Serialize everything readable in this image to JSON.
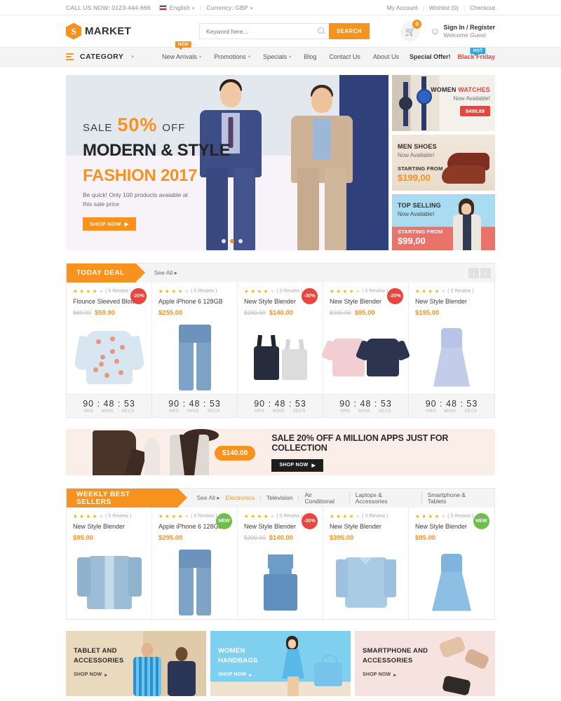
{
  "topbar": {
    "call": "CALL US NOW:  0123-444-666",
    "language": "English",
    "currency": "Currency: GBP",
    "my_account": "My Account",
    "wishlist": "Wishlist (0)",
    "checkout": "Checkout",
    "sep": "|"
  },
  "header": {
    "logo_mark": "S",
    "logo_text": "MARKET",
    "search_placeholder": "Keyword here...",
    "search_value": "",
    "search_button": "SEARCH",
    "cart_count": "0",
    "account_line1": "Sign In / Register",
    "account_line2": "Welcome Guest"
  },
  "nav": {
    "category_label": "CATEGORY",
    "items": [
      {
        "label": "New Arrivals",
        "caret": true,
        "badge": "NEW",
        "badge_type": "new"
      },
      {
        "label": "Promotions",
        "caret": true,
        "badge": "",
        "badge_type": ""
      },
      {
        "label": "Specials",
        "caret": true,
        "badge": "",
        "badge_type": ""
      },
      {
        "label": "Blog",
        "caret": false,
        "badge": "",
        "badge_type": ""
      },
      {
        "label": "Contact Us",
        "caret": false,
        "badge": "",
        "badge_type": ""
      },
      {
        "label": "About Us",
        "caret": false,
        "badge": "",
        "badge_type": ""
      }
    ],
    "special_offer": "Special Offer!",
    "black_friday": "Black Friday",
    "black_friday_badge": "HOT"
  },
  "hero": {
    "sale_pre": "SALE",
    "sale_pct": "50%",
    "sale_post": "OFF",
    "title1": "MODERN & STYLE",
    "title2": "FASHION 2017",
    "desc": "Be quick! Only 100 products avaiable at this sale price",
    "button": "SHOP NOW",
    "dots": 3,
    "active_dot": 1
  },
  "promos": [
    {
      "name": "women-watches",
      "title_a": "WOMEN ",
      "title_b": "WATCHES",
      "subtitle": "Now Available!",
      "price": "$499,89",
      "price_style": "red-pill"
    },
    {
      "name": "men-shoes",
      "title_a": "MEN SHOES",
      "title_b": "",
      "subtitle": "Now Available!",
      "from_label": "STARTING FROM",
      "price": "$199,00",
      "price_style": "orange"
    },
    {
      "name": "top-selling",
      "title_a": "TOP SELLING",
      "title_b": "",
      "subtitle": "Now Available!",
      "from_label": "STARTING FROM",
      "price": "$99,00",
      "price_style": "white"
    }
  ],
  "today_deal": {
    "title": "TODAY DEAL",
    "see_all": "See All",
    "prev": "‹",
    "next": "›",
    "review_text": "( 0 Review )",
    "timer_labels": [
      "HRS",
      "MINS",
      "SECS"
    ],
    "products": [
      {
        "name": "Flounce Sleeved Blouse",
        "old_price": "$89.00",
        "price": "$59.90",
        "badge": "-20%",
        "badge_type": "sale",
        "timer": "90 : 48 : 53",
        "img": "blouse"
      },
      {
        "name": "Apple iPhone 6 128GB",
        "old_price": "",
        "price": "$255.00",
        "badge": "",
        "badge_type": "",
        "timer": "90 : 48 : 53",
        "img": "jeans"
      },
      {
        "name": "New Style Blender",
        "old_price": "$200.00",
        "price": "$140.00",
        "badge": "-30%",
        "badge_type": "sale",
        "timer": "90 : 48 : 53",
        "img": "tank"
      },
      {
        "name": "New Style Blender",
        "old_price": "$105.00",
        "price": "$95.00",
        "badge": "-20%",
        "badge_type": "sale",
        "timer": "90 : 48 : 53",
        "img": "tee"
      },
      {
        "name": "New Style Blender",
        "old_price": "",
        "price": "$195.00",
        "badge": "",
        "badge_type": "",
        "timer": "90 : 48 : 53",
        "img": "dress"
      }
    ]
  },
  "mid_banner": {
    "price": "$140.00",
    "title": "SALE 20% OFF A MILLION APPS JUST FOR COLLECTION",
    "button": "SHOP NOW"
  },
  "weekly": {
    "title": "WEEKLY BEST SELLERS",
    "see_all": "See All",
    "review_text": "( 0 Review )",
    "tabs": [
      {
        "label": "Electronics",
        "active": true
      },
      {
        "label": "Television",
        "active": false
      },
      {
        "label": "Air Conditional",
        "active": false
      },
      {
        "label": "Laptops & Accessories",
        "active": false
      },
      {
        "label": "Smartphone & Tablets",
        "active": false
      }
    ],
    "products": [
      {
        "name": "New Style Blender",
        "old_price": "",
        "price": "$95.00",
        "badge": "",
        "badge_type": "",
        "img": "jacket"
      },
      {
        "name": "Apple iPhone 6 128GB",
        "old_price": "",
        "price": "$295.00",
        "badge": "NEW",
        "badge_type": "newb",
        "img": "jeans"
      },
      {
        "name": "New Style Blender",
        "old_price": "$200.00",
        "price": "$140.00",
        "badge": "-30%",
        "badge_type": "sale",
        "img": "overall"
      },
      {
        "name": "New Style Blender",
        "old_price": "",
        "price": "$395.00",
        "badge": "",
        "badge_type": "",
        "img": "shirt"
      },
      {
        "name": "New Style Blender",
        "old_price": "",
        "price": "$95.00",
        "badge": "NEW",
        "badge_type": "newb",
        "img": "bdress"
      }
    ]
  },
  "cat_banners": [
    {
      "line1": "TABLET AND",
      "line2": "ACCESSORIES",
      "button": "SHOP NOW"
    },
    {
      "line1": "WOMEN",
      "line2": "HANDBAGS",
      "button": "SHOP NOW"
    },
    {
      "line1": "SMARTPHONE AND",
      "line2": "ACCESSORIES",
      "button": "SHOP NOW"
    }
  ],
  "colors": {
    "accent": "#f7921e",
    "sale": "#e8453c",
    "new": "#6cc04a",
    "hot": "#3aa5dc"
  }
}
